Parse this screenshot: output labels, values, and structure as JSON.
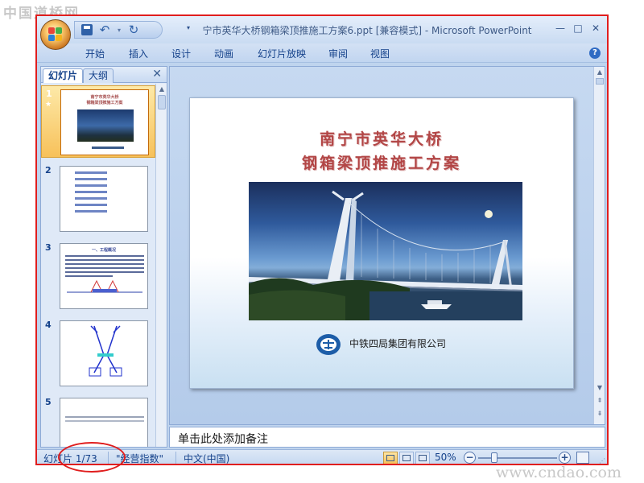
{
  "watermarks": {
    "top_left": "中国道桥网",
    "bottom_right": "www.cndao.com"
  },
  "window": {
    "title": "宁市英华大桥钢箱梁顶推施工方案6.ppt [兼容模式] - Microsoft PowerPoint",
    "controls": {
      "minimize": "—",
      "maximize": "□",
      "close": "✕"
    }
  },
  "quick_access": {
    "undo_symbol": "↶",
    "redo_symbol": "↻",
    "dropdown_symbol": "▾",
    "customize_symbol": "▾"
  },
  "ribbon": {
    "tabs": [
      "开始",
      "插入",
      "设计",
      "动画",
      "幻灯片放映",
      "审阅",
      "视图"
    ],
    "help": "?"
  },
  "left_panel": {
    "tabs": {
      "slides": "幻灯片",
      "outline": "大纲"
    },
    "close": "✕",
    "thumbnails": [
      {
        "number": "1",
        "selected": true,
        "title_l1": "南宁市英华大桥",
        "title_l2": "钢箱梁顶推施工方案"
      },
      {
        "number": "2",
        "selected": false
      },
      {
        "number": "3",
        "selected": false,
        "heading": "一、工程概况"
      },
      {
        "number": "4",
        "selected": false
      },
      {
        "number": "5",
        "selected": false
      }
    ],
    "thumb_badge": "★"
  },
  "slide": {
    "title_line1": "南宁市英华大桥",
    "title_line2": "钢箱梁顶推施工方案",
    "company": "中铁四局集团有限公司"
  },
  "notes": {
    "placeholder": "单击此处添加备注"
  },
  "statusbar": {
    "slide_indicator": "幻灯片 1/73",
    "theme": "\"经营指数\"",
    "language": "中文(中国)",
    "zoom": "50%",
    "zoom_minus": "−",
    "zoom_plus": "+",
    "grip": "⋰"
  },
  "scroll_symbols": {
    "up": "▲",
    "down": "▼",
    "prev": "⇞",
    "next": "⇟"
  }
}
